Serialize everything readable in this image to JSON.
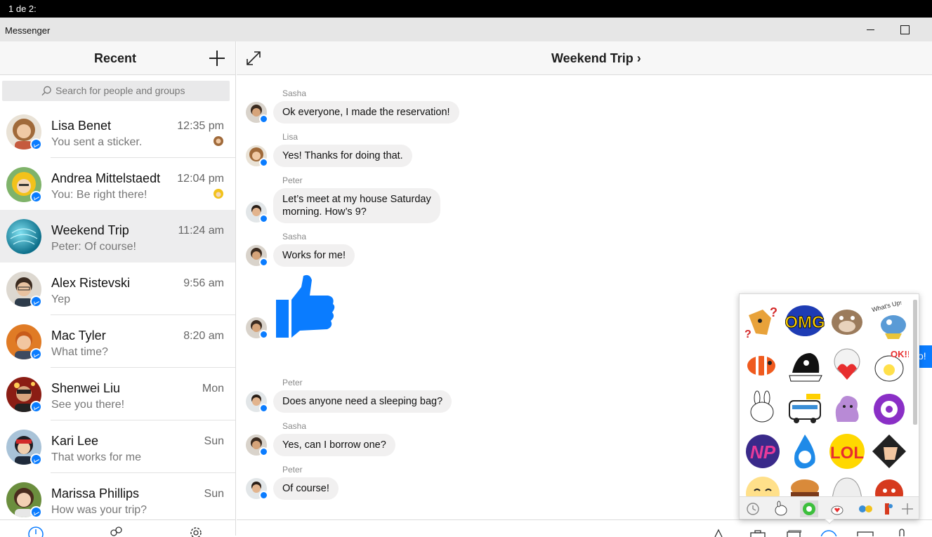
{
  "status_bar": {
    "text": "1 de 2:"
  },
  "window": {
    "title": "Messenger"
  },
  "sidebar": {
    "header": "Recent",
    "search_placeholder": "Search for people and groups",
    "conversations": [
      {
        "name": "Lisa Benet",
        "time": "12:35 pm",
        "preview": "You sent a sticker.",
        "avatar_color": "#d9a86a"
      },
      {
        "name": "Andrea Mittelstaedt",
        "time": "12:04 pm",
        "preview": "You: Be right there!",
        "avatar_color": "#f2c21b"
      },
      {
        "name": "Weekend Trip",
        "time": "11:24 am",
        "preview": "Peter: Of course!",
        "avatar_color": "#23a4c4"
      },
      {
        "name": "Alex Ristevski",
        "time": "9:56 am",
        "preview": "Yep",
        "avatar_color": "#c9b7a0"
      },
      {
        "name": "Mac Tyler",
        "time": "8:20 am",
        "preview": "What time?",
        "avatar_color": "#e07b25"
      },
      {
        "name": "Shenwei Liu",
        "time": "Mon",
        "preview": "See you there!",
        "avatar_color": "#8b1d14"
      },
      {
        "name": "Kari Lee",
        "time": "Sun",
        "preview": "That works for me",
        "avatar_color": "#4a7ca8"
      },
      {
        "name": "Marissa Phillips",
        "time": "Sun",
        "preview": "How was your trip?",
        "avatar_color": "#6b8e3e"
      }
    ]
  },
  "chat": {
    "title": "Weekend Trip",
    "messages": [
      {
        "sender": "Sasha",
        "text": "Ok everyone, I made the reservation!"
      },
      {
        "sender": "Lisa",
        "text": "Yes! Thanks for doing that."
      },
      {
        "sender": "Peter",
        "line1": "Let’s meet at my house Saturday",
        "line2": "morning. How’s 9?"
      },
      {
        "sender": "Sasha",
        "text": "Works for me!"
      },
      {
        "sender": "Peter",
        "text": "Does anyone need a sleeping bag?"
      },
      {
        "sender": "Sasha",
        "text": "Yes, can I borrow one?"
      },
      {
        "sender": "Peter",
        "text": "Of course!"
      }
    ],
    "edge_bubble_text": "o!"
  },
  "stickers": {
    "omg": "OMG",
    "whats_up": "What's Up!",
    "ok": "OK!!",
    "np": "NP",
    "lol": "LOL"
  },
  "colors": {
    "accent": "#0a7cff",
    "bubble": "#f1f0f0",
    "header_bg": "#f7f7f7",
    "active_row": "#ededee"
  }
}
